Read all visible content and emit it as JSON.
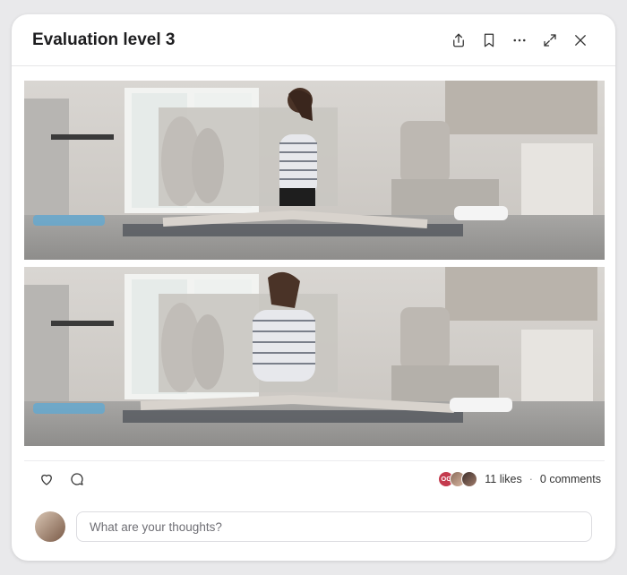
{
  "post": {
    "title": "Evaluation level 3"
  },
  "header_icons": [
    "share-icon",
    "bookmark-icon",
    "more-icon",
    "expand-icon",
    "close-icon"
  ],
  "media": {
    "frames": [
      {
        "alt": "video-frame-1"
      },
      {
        "alt": "video-frame-2"
      }
    ]
  },
  "stats": {
    "avatar_initials": "OG",
    "likes": "11 likes",
    "separator": "·",
    "comments": "0 comments"
  },
  "composer": {
    "placeholder": "What are your thoughts?"
  },
  "colors": {
    "avatar_accent": "#c43b4e",
    "border": "#e6e6e8"
  }
}
